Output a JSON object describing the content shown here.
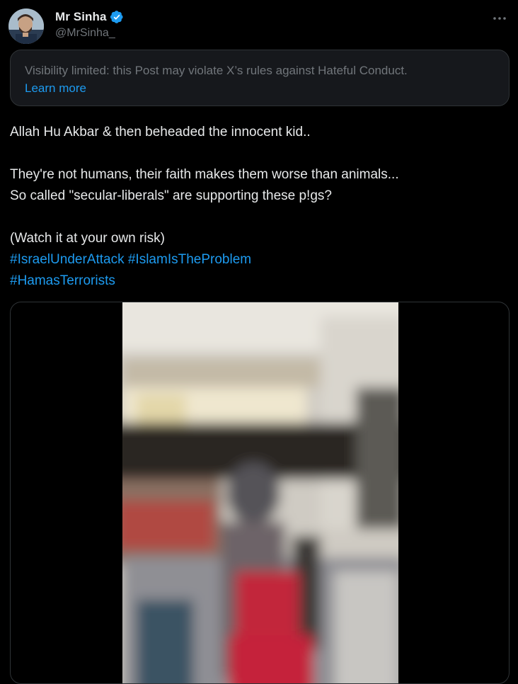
{
  "user": {
    "display_name": "Mr Sinha",
    "handle": "@MrSinha_",
    "verified": true,
    "verified_color": "#1d9bf0"
  },
  "notice": {
    "text": "Visibility limited: this Post may violate X’s rules against Hateful Conduct.",
    "link_label": "Learn more"
  },
  "tweet": {
    "line1": "Allah Hu Akbar & then beheaded the innocent kid..",
    "line2": "They're not humans, their faith makes them worse than animals...",
    "line3": "So called \"secular-liberals\" are supporting these p!gs?",
    "line4": "(Watch it at your own risk)",
    "hashtags": [
      "#IsraelUnderAttack",
      "#IslamIsTheProblem",
      "#HamasTerrorists"
    ]
  },
  "media": {
    "kind": "video",
    "blurred": true
  },
  "icons": {
    "more": "more-options-icon",
    "verified": "verified-badge-icon",
    "avatar": "profile-avatar"
  },
  "colors": {
    "background": "#000000",
    "text": "#e7e9ea",
    "secondary_text": "#71767b",
    "link": "#1d9bf0",
    "card_bg": "#16181c",
    "border": "#2f3336"
  }
}
